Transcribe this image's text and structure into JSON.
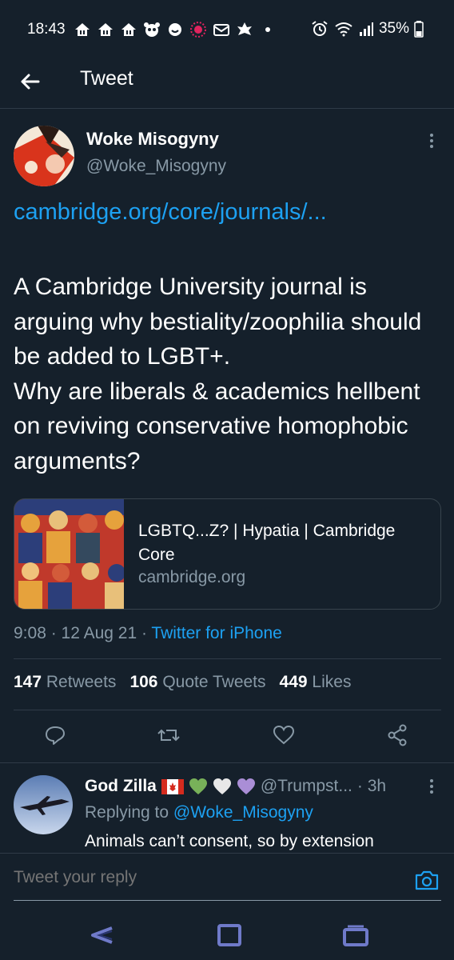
{
  "status_bar": {
    "time": "18:43",
    "battery": "35%",
    "notification_icons": [
      "home-icon",
      "home-icon",
      "home-icon",
      "panda-icon",
      "smiley-icon",
      "record-icon",
      "mail-icon",
      "leaf-icon",
      "dot-icon"
    ]
  },
  "header": {
    "title": "Tweet"
  },
  "tweet": {
    "author_name": "Woke Misogyny",
    "author_handle": "@Woke_Misogyny",
    "link": "cambridge.org/core/journals/...",
    "body": "A Cambridge University journal is arguing why bestiality/zoophilia should be added to LGBT+.\nWhy are liberals & academics hellbent on reviving conservative homophobic arguments?",
    "card": {
      "title": "LGBTQ...Z? | Hypatia | Cambridge Core",
      "domain": "cambridge.org"
    },
    "timestamp": "9:08 · 12 Aug 21 · ",
    "source": "Twitter for iPhone",
    "stats": {
      "retweets_count": "147",
      "retweets_label": "Retweets",
      "quotes_count": "106",
      "quotes_label": "Quote Tweets",
      "likes_count": "449",
      "likes_label": "Likes"
    }
  },
  "reply": {
    "name": "God Zilla",
    "handle": "@Trumpst...",
    "time": "· 3h",
    "replying_prefix": "Replying to ",
    "replying_to": "@Woke_Misogyny",
    "text": "Animals can’t consent, so by extension"
  },
  "composer": {
    "placeholder": "Tweet your reply"
  },
  "colors": {
    "background": "#15202b",
    "accent": "#1da1f2",
    "secondary_text": "#8899a6",
    "divider": "#2f3b47"
  }
}
